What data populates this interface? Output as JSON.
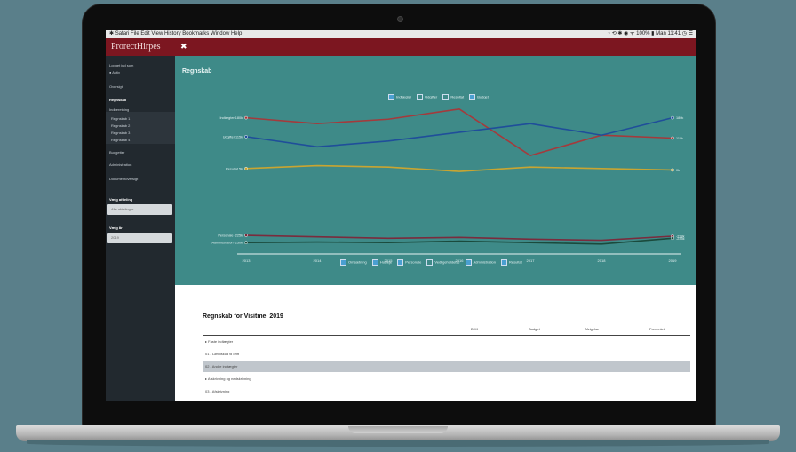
{
  "menubar": {
    "left": "✱ Safari File Edit View History Bookmarks Window Help",
    "right": "◔ ⟲ ✱ ◉ ᯤ 100% ▮ Man 11:41 ◷ ☰"
  },
  "app": {
    "brand": "ProrectHirpes",
    "menu_icon": "✖"
  },
  "sidebar": {
    "top_label": "Logget ind som",
    "user": "● Aktiv",
    "items": [
      {
        "label": "Oversigt"
      },
      {
        "label": "Regnskab"
      },
      {
        "label": "Indberetning"
      },
      {
        "label": "Budgetter"
      },
      {
        "label": "Administration"
      },
      {
        "label": "Dokumentoversigt"
      }
    ],
    "subitems": [
      {
        "label": "Regnskab 1"
      },
      {
        "label": "Regnskab 2"
      },
      {
        "label": "Regnskab 3"
      },
      {
        "label": "Regnskab 4"
      }
    ],
    "filter1_label": "Vælg afdeling",
    "filter1_value": "Alle afdelinger",
    "filter2_label": "Vælg år",
    "filter2_value": "2019"
  },
  "page": {
    "title": "Regnskab"
  },
  "top_legend": [
    {
      "label": "Indtægter",
      "checked": true
    },
    {
      "label": "Udgifter",
      "checked": false
    },
    {
      "label": "Resultat",
      "checked": false
    },
    {
      "label": "Budget",
      "checked": true
    }
  ],
  "bottom_legend": [
    {
      "label": "Omsætning",
      "checked": true
    },
    {
      "label": "Husleje",
      "checked": true
    },
    {
      "label": "Personale",
      "checked": true
    },
    {
      "label": "Vedligeholdelse",
      "checked": false
    },
    {
      "label": "Administration",
      "checked": true
    },
    {
      "label": "Resultat",
      "checked": true
    }
  ],
  "chart_data": {
    "type": "line",
    "x": [
      "2013",
      "2014",
      "2015",
      "2016",
      "2017",
      "2018",
      "2019"
    ],
    "series": [
      {
        "values": [
          180,
          160,
          175,
          210,
          50,
          120,
          110
        ],
        "color": "#a43a3c",
        "start_label": "Indtægter 180k",
        "end_label": "110k"
      },
      {
        "values": [
          115,
          80,
          100,
          130,
          160,
          120,
          180
        ],
        "color": "#1f4e9a",
        "start_label": "Udgifter 115k",
        "end_label": "180k"
      },
      {
        "values": [
          5,
          15,
          10,
          -5,
          10,
          5,
          0
        ],
        "color": "#c9a531",
        "start_label": "Resultat 5k",
        "end_label": "0k"
      },
      {
        "values": [
          -225,
          -230,
          -235,
          -232,
          -238,
          -242,
          -228
        ],
        "color": "#7a2b3d",
        "start_label": "Personale -225k",
        "end_label": "-228k"
      },
      {
        "values": [
          -250,
          -248,
          -250,
          -245,
          -250,
          -255,
          -235
        ],
        "color": "#1a4a3c",
        "start_label": "Administration -250k",
        "end_label": "-235k"
      }
    ],
    "ylim": [
      -280,
      240
    ]
  },
  "table": {
    "title": "Regnskab for Visitme, 2019",
    "columns": [
      "DKK",
      "Budget",
      "Afvigelse",
      "Forventet"
    ],
    "rows": [
      {
        "label": "▸ Faste indtægter",
        "highlight": false
      },
      {
        "label": "01 - Løntilskud til drift",
        "highlight": false
      },
      {
        "label": "02 - Andre indtægter",
        "highlight": true
      },
      {
        "label": "▸ Afskrivning og nedskrivning",
        "highlight": false
      },
      {
        "label": "03 - Afskrivning",
        "highlight": false
      }
    ]
  }
}
